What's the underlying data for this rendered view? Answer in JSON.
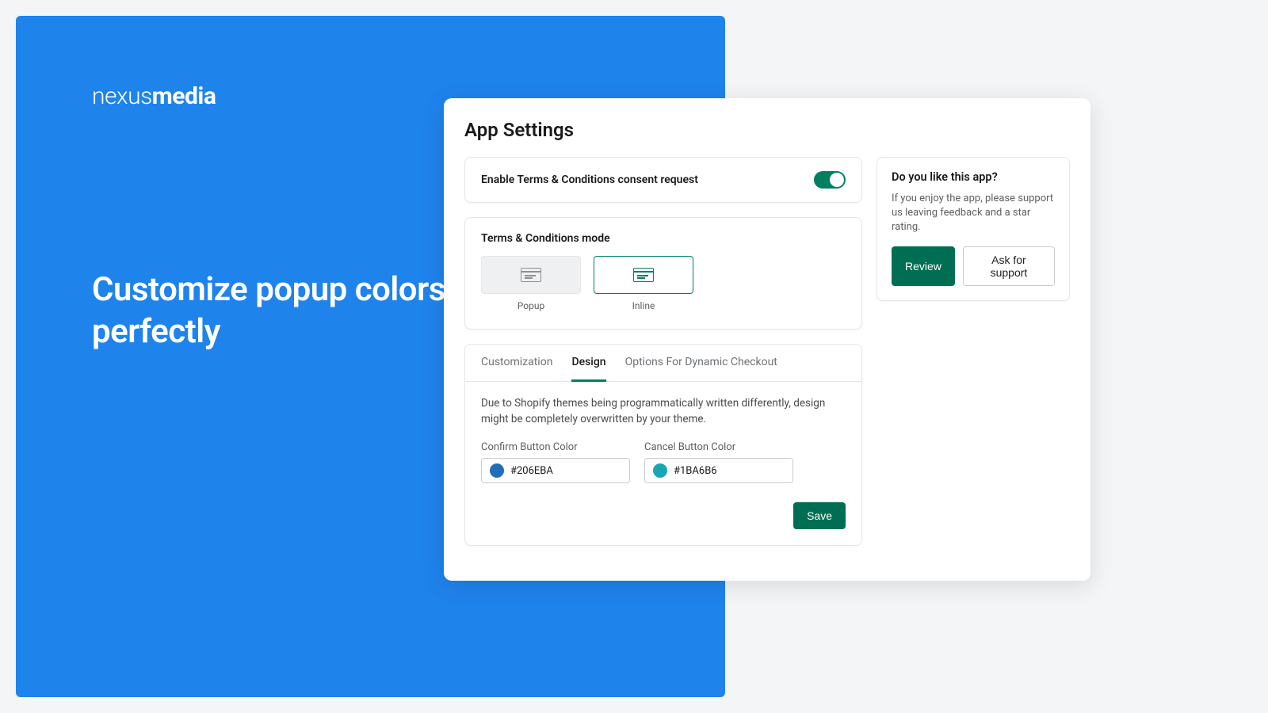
{
  "brand": {
    "part1": "nexus",
    "part2": "media"
  },
  "headline": "Customize popup colors to fit your theme perfectly",
  "settings": {
    "title": "App Settings",
    "enable_label": "Enable Terms & Conditions consent request",
    "mode": {
      "title": "Terms & Conditions mode",
      "options": [
        {
          "label": "Popup",
          "active": false
        },
        {
          "label": "Inline",
          "active": true
        }
      ]
    },
    "tabs": [
      {
        "label": "Customization",
        "active": false
      },
      {
        "label": "Design",
        "active": true
      },
      {
        "label": "Options For Dynamic Checkout",
        "active": false
      }
    ],
    "design": {
      "note": "Due to Shopify themes being programmatically written differently, design might be completely overwritten by your theme.",
      "confirm_label": "Confirm Button Color",
      "confirm_value": "#206EBA",
      "cancel_label": "Cancel Button Color",
      "cancel_value": "#1BA6B6",
      "save_label": "Save"
    }
  },
  "promo": {
    "title": "Do you like this app?",
    "text": "If you enjoy the app, please support us leaving feedback and a star rating.",
    "review_label": "Review",
    "support_label": "Ask for support"
  },
  "colors": {
    "confirm_swatch": "#206EBA",
    "cancel_swatch": "#1BA6B6"
  }
}
